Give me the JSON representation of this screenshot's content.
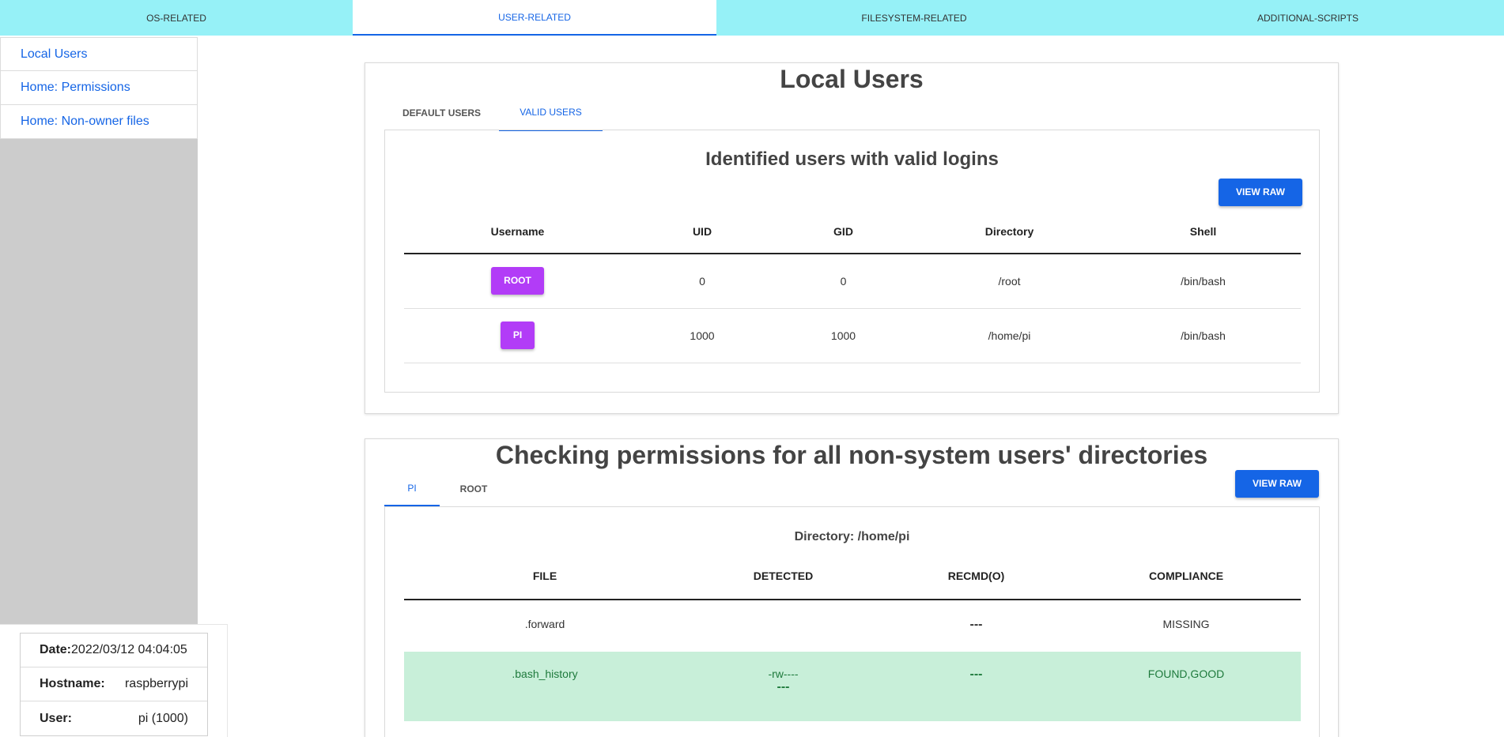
{
  "topnav": {
    "tabs": [
      {
        "label": "OS-RELATED"
      },
      {
        "label": "USER-RELATED"
      },
      {
        "label": "FILESYSTEM-RELATED"
      },
      {
        "label": "ADDITIONAL-SCRIPTS"
      }
    ],
    "active_index": 1
  },
  "sidebar": {
    "items": [
      {
        "label": "Local Users"
      },
      {
        "label": "Home: Permissions"
      },
      {
        "label": "Home: Non-owner files"
      }
    ]
  },
  "info": {
    "date_label": "Date:",
    "date_value": "2022/03/12 04:04:05",
    "hostname_label": "Hostname:",
    "hostname_value": "raspberrypi",
    "user_label": "User:",
    "user_value": "pi (1000)"
  },
  "local_users": {
    "title": "Local Users",
    "tabs": [
      {
        "label": "DEFAULT USERS"
      },
      {
        "label": "VALID USERS"
      }
    ],
    "active_tab": 1,
    "section_title": "Identified users with valid logins",
    "view_raw_label": "VIEW RAW",
    "columns": [
      "Username",
      "UID",
      "GID",
      "Directory",
      "Shell"
    ],
    "rows": [
      {
        "username": "ROOT",
        "uid": "0",
        "gid": "0",
        "directory": "/root",
        "shell": "/bin/bash"
      },
      {
        "username": "PI",
        "uid": "1000",
        "gid": "1000",
        "directory": "/home/pi",
        "shell": "/bin/bash"
      }
    ]
  },
  "permissions": {
    "title": "Checking permissions for all non-system users' directories",
    "tabs": [
      {
        "label": "PI"
      },
      {
        "label": "ROOT"
      }
    ],
    "active_tab": 0,
    "view_raw_label": "VIEW RAW",
    "directory_label": "Directory: /home/pi",
    "columns": [
      "FILE",
      "DETECTED",
      "RECMD(O)",
      "COMPLIANCE"
    ],
    "rows": [
      {
        "file": ".forward",
        "detected": "",
        "detected_extra": "",
        "recmd": "---",
        "compliance": "MISSING",
        "status": "missing"
      },
      {
        "file": ".bash_history",
        "detected": "-rw----",
        "detected_extra": "---",
        "recmd": "---",
        "compliance": "FOUND,GOOD",
        "status": "good"
      }
    ]
  },
  "colors": {
    "nav_bg": "#96f1f7",
    "accent": "#1565e6",
    "user_button": "#b23cf7",
    "good_row_bg": "#c8efd9",
    "good_row_text": "#1e7a3c",
    "sidebar_bg": "#cccccc"
  }
}
